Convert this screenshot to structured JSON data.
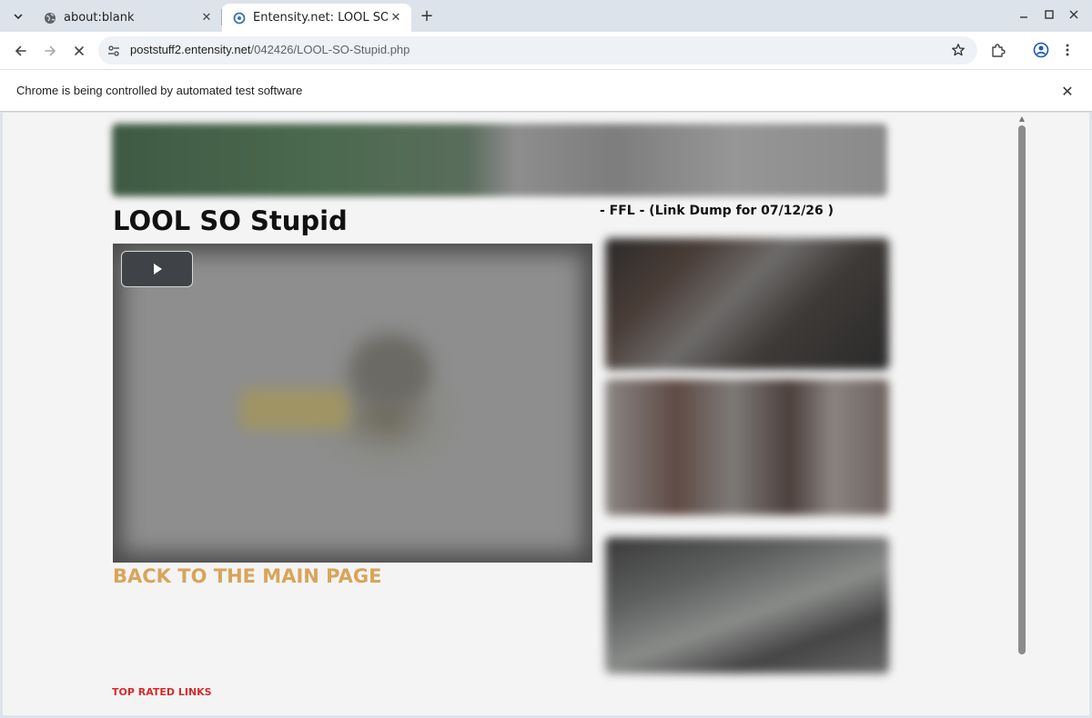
{
  "browser": {
    "tabs": [
      {
        "title": "about:blank",
        "active": false
      },
      {
        "title": "Entensity.net: LOOL SO St",
        "active": true
      }
    ],
    "address_bar": {
      "host": "poststuff2.entensity.net",
      "path": "/042426/LOOL-SO-Stupid.php"
    },
    "infobar_message": "Chrome is being controlled by automated test software",
    "icons": {
      "tab_menu": "chevron-down-icon",
      "back": "arrow-left-icon",
      "forward": "arrow-right-icon",
      "stop": "close-icon",
      "site_info": "tune-icon",
      "bookmark": "star-icon",
      "extensions": "puzzle-icon",
      "profile": "account-icon",
      "menu": "kebab-menu-icon"
    }
  },
  "page": {
    "title": "LOOL SO Stupid",
    "back_link": "BACK TO THE MAIN PAGE",
    "top_rated_label": "TOP RATED LINKS",
    "sidebar_heading": "- FFL - (Link Dump for 07/12/26 )",
    "colors": {
      "back_link": "#d9a45a",
      "top_rated": "#d42b2b",
      "page_bg": "#f4f4f4"
    }
  }
}
